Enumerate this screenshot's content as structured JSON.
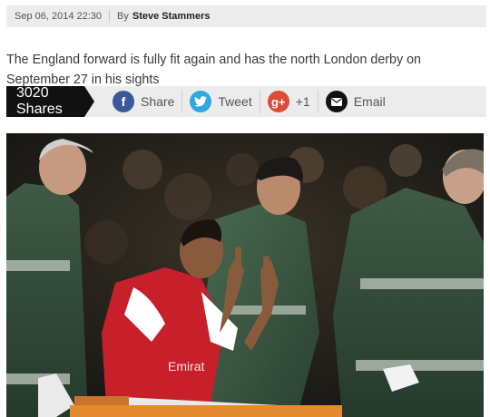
{
  "meta": {
    "date": "Sep 06, 2014 22:30",
    "by_label": "By",
    "author": "Steve Stammers"
  },
  "summary": "The England forward is fully fit again and has the north London derby on September 27 in his sights",
  "share": {
    "count_label": "3020 Shares",
    "facebook_label": "Share",
    "twitter_label": "Tweet",
    "gplus_label": "+1",
    "email_label": "Email",
    "colors": {
      "facebook": "#3b5998",
      "twitter": "#2fa7e0",
      "gplus": "#dd4b39",
      "email": "#111111"
    }
  },
  "photo": {
    "icon": "article-photo",
    "jersey_text": "Emirat"
  }
}
